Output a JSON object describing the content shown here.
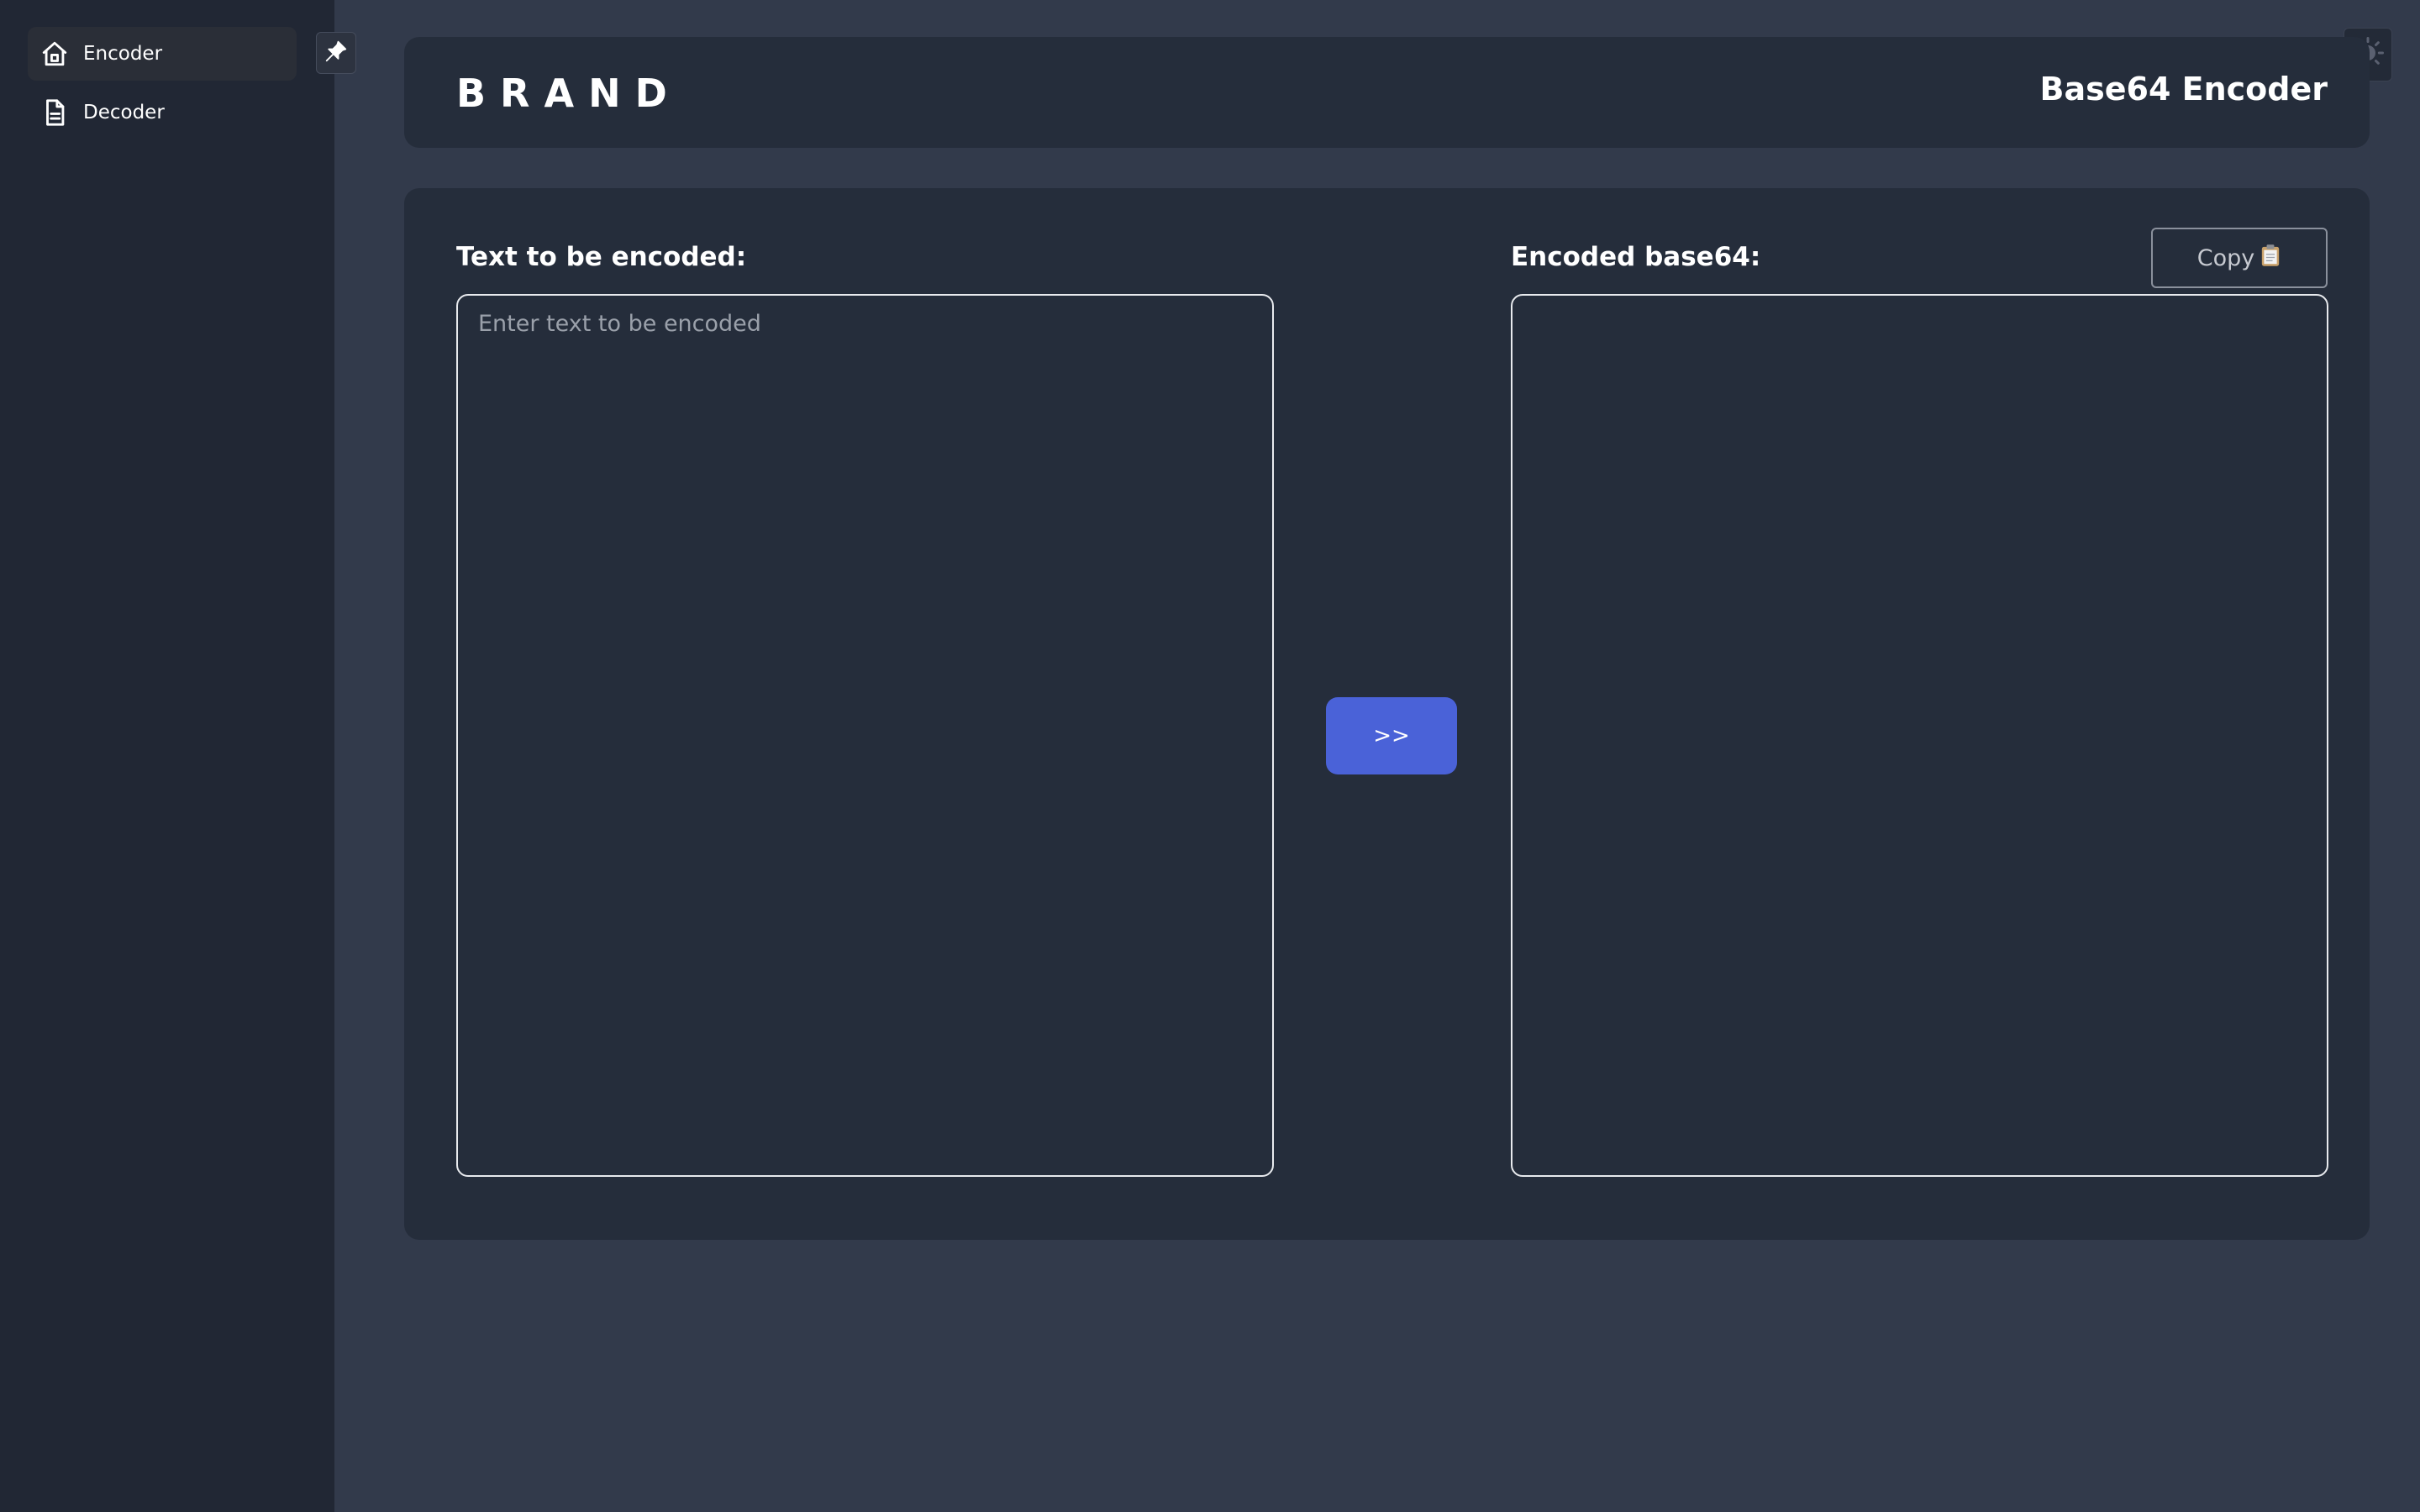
{
  "sidebar": {
    "items": [
      {
        "label": "Encoder",
        "icon": "home-icon",
        "active": true
      },
      {
        "label": "Decoder",
        "icon": "document-icon",
        "active": false
      }
    ],
    "pin_icon": "pin-icon"
  },
  "header": {
    "brand": "BRAND",
    "title": "Base64 Encoder",
    "theme_icon": "sun-icon"
  },
  "main": {
    "input_label": "Text to be encoded:",
    "input_placeholder": "Enter text to be encoded",
    "input_value": "",
    "output_label": "Encoded base64:",
    "output_value": "",
    "encode_button_label": ">>",
    "copy_button_label": "Copy",
    "copy_icon": "clipboard-icon"
  },
  "colors": {
    "sidebar_bg": "#212734",
    "page_bg": "#323a4b",
    "card_bg": "#252d3b",
    "accent": "#4a62d8"
  }
}
